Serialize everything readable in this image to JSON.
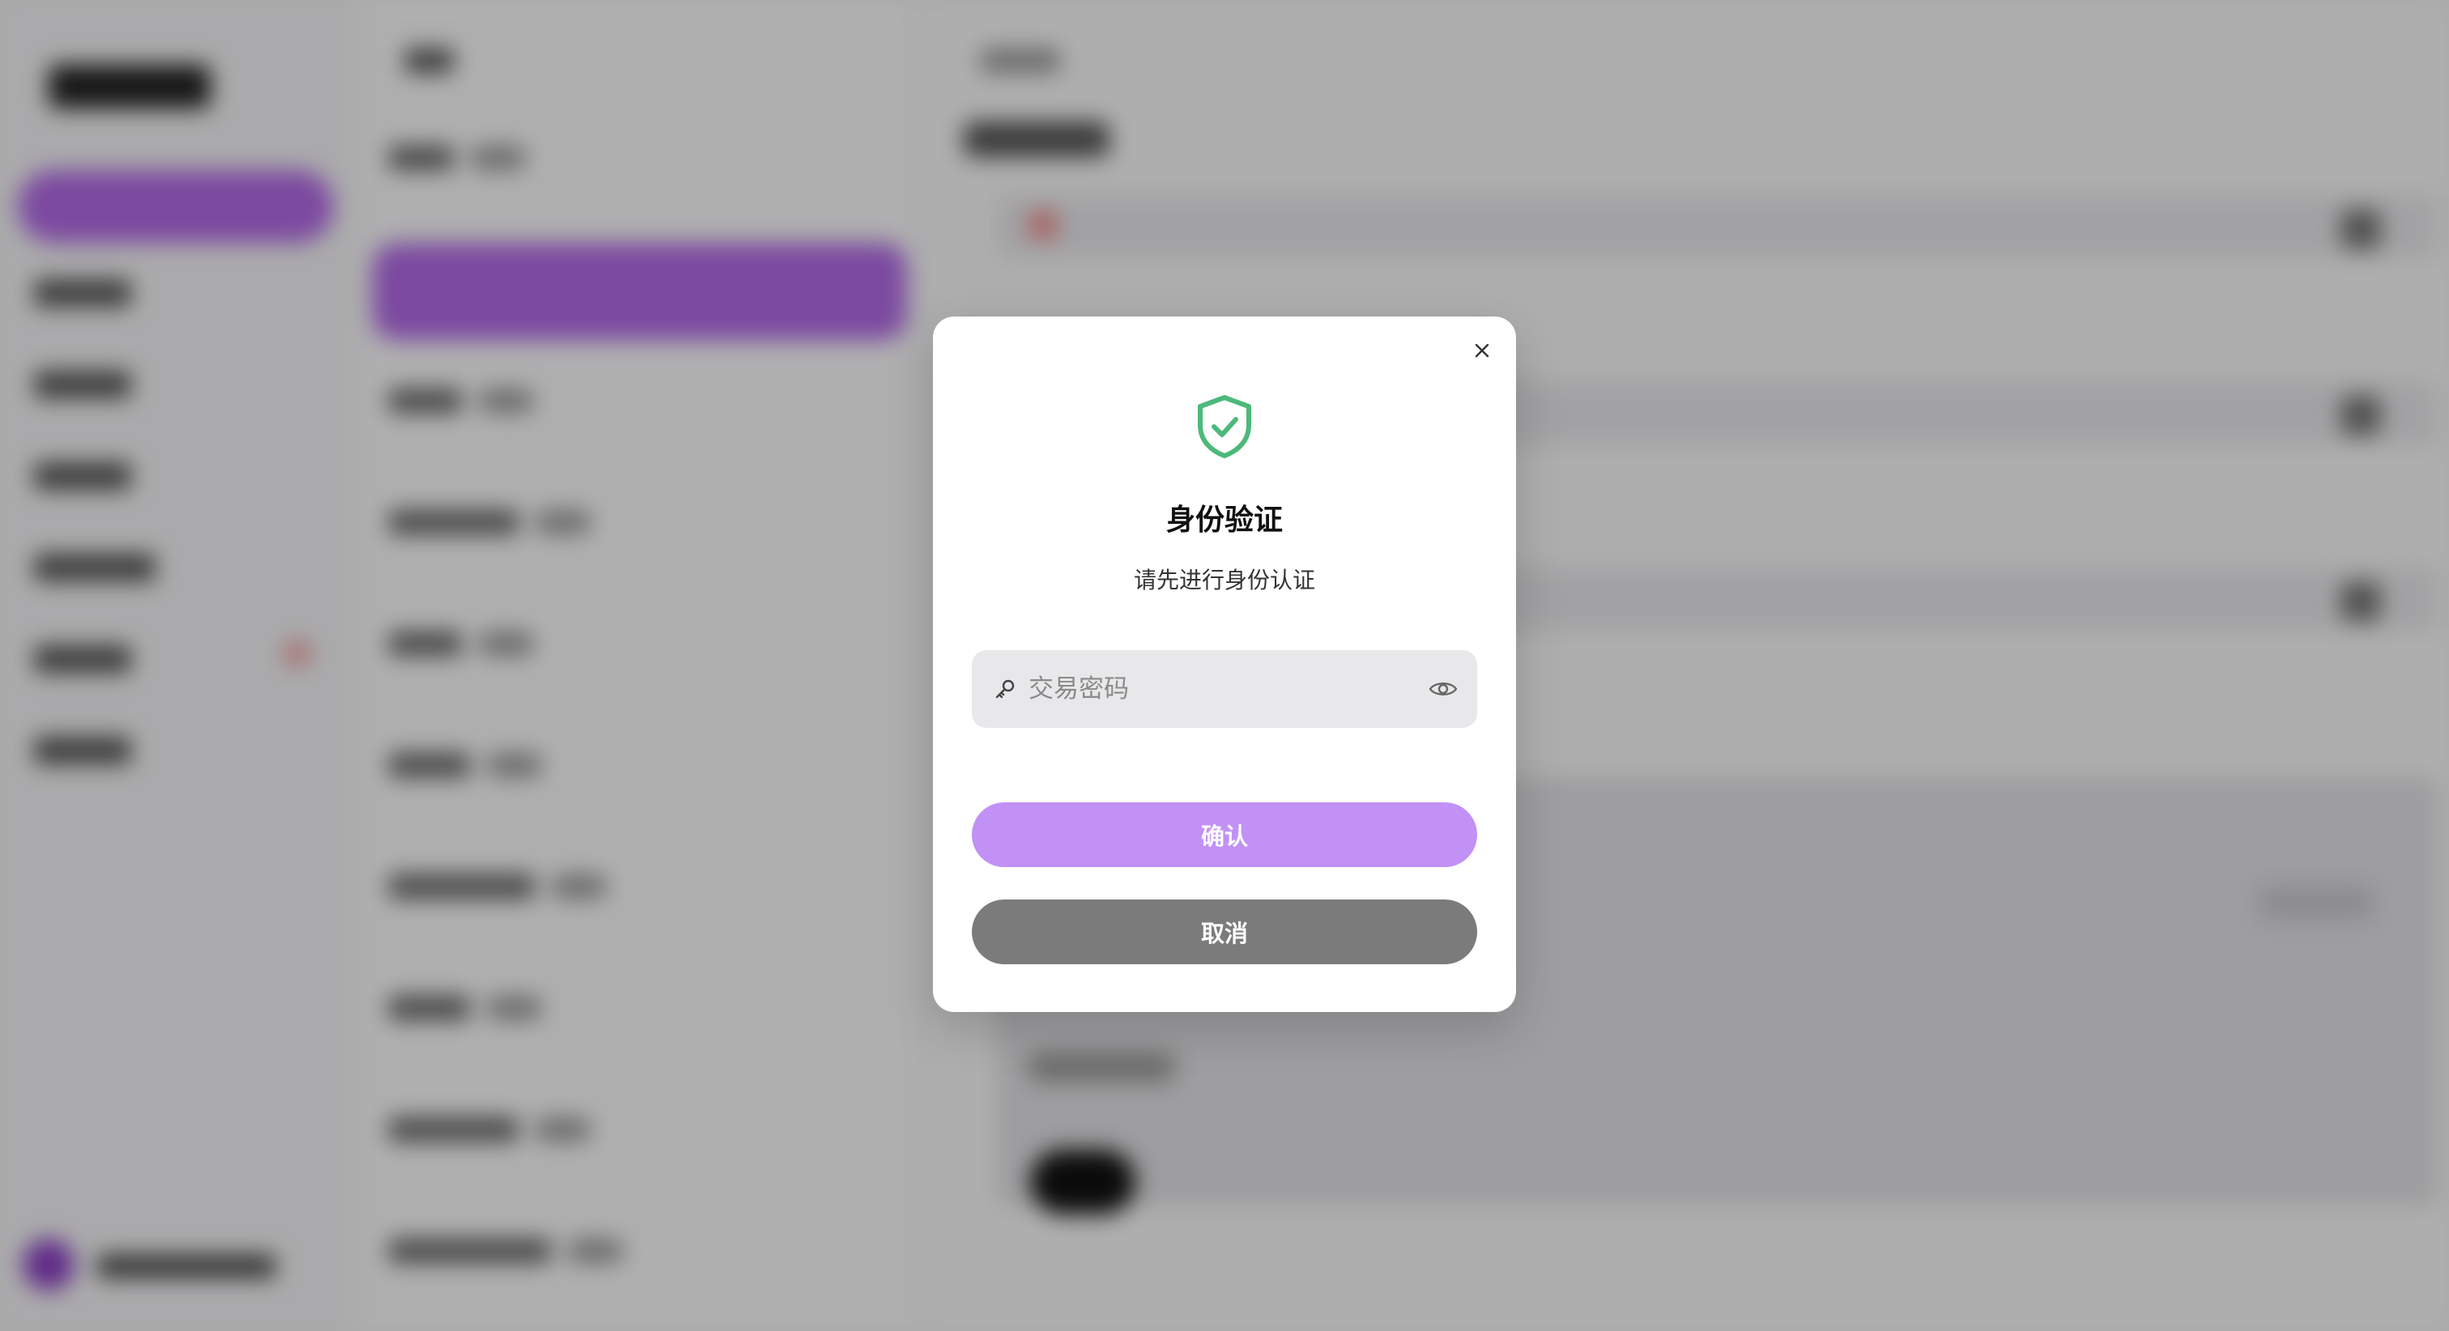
{
  "dialog": {
    "title": "身份验证",
    "subtitle": "请先进行身份认证",
    "password_placeholder": "交易密码",
    "password_value": "",
    "confirm_label": "确认",
    "cancel_label": "取消"
  },
  "icons": {
    "shield": "shield-check-icon",
    "close": "close-icon",
    "key": "key-icon",
    "eye": "eye-icon"
  },
  "colors": {
    "accent": "#c191f6",
    "success": "#4cb97a",
    "cancel": "#7b7b7b",
    "input_bg": "#e8e8ea"
  }
}
